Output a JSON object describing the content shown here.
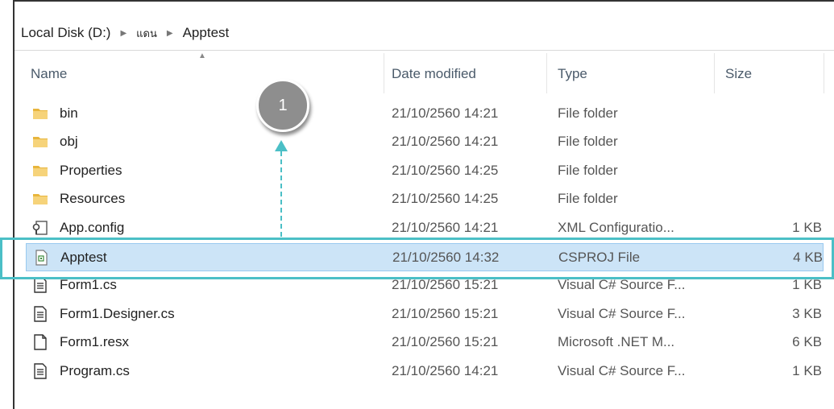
{
  "breadcrumb": [
    "Local Disk (D:)",
    "แดน",
    "Apptest"
  ],
  "columns": {
    "name": "Name",
    "date": "Date modified",
    "type": "Type",
    "size": "Size"
  },
  "files": [
    {
      "name": "bin",
      "date": "21/10/2560 14:21",
      "type": "File folder",
      "size": "",
      "icon": "folder-icon"
    },
    {
      "name": "obj",
      "date": "21/10/2560 14:21",
      "type": "File folder",
      "size": "",
      "icon": "folder-icon"
    },
    {
      "name": "Properties",
      "date": "21/10/2560 14:25",
      "type": "File folder",
      "size": "",
      "icon": "folder-icon"
    },
    {
      "name": "Resources",
      "date": "21/10/2560 14:25",
      "type": "File folder",
      "size": "",
      "icon": "folder-icon"
    },
    {
      "name": "App.config",
      "date": "21/10/2560 14:21",
      "type": "XML Configuratio...",
      "size": "1 KB",
      "icon": "config-file-icon"
    },
    {
      "name": "Apptest",
      "date": "21/10/2560 14:32",
      "type": "CSPROJ File",
      "size": "4 KB",
      "icon": "csproj-file-icon"
    },
    {
      "name": "Form1.cs",
      "date": "21/10/2560 15:21",
      "type": "Visual C# Source F...",
      "size": "1 KB",
      "icon": "text-file-icon"
    },
    {
      "name": "Form1.Designer.cs",
      "date": "21/10/2560 15:21",
      "type": "Visual C# Source F...",
      "size": "3 KB",
      "icon": "text-file-icon"
    },
    {
      "name": "Form1.resx",
      "date": "21/10/2560 15:21",
      "type": "Microsoft .NET M...",
      "size": "6 KB",
      "icon": "blank-file-icon"
    },
    {
      "name": "Program.cs",
      "date": "21/10/2560 14:21",
      "type": "Visual C# Source F...",
      "size": "1 KB",
      "icon": "text-file-icon"
    }
  ],
  "annotation": {
    "step_number": "1"
  },
  "colors": {
    "highlight": "#4bbfc6",
    "selected_row": "#cce4f7",
    "folder": "#e8b53c"
  }
}
